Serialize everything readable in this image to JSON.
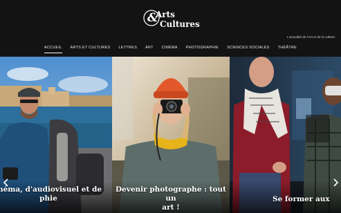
{
  "logo": {
    "line1": "Arts",
    "line2": "Cultures",
    "prefix": "&",
    "tagline": "L'actualité de l'Art et de la culture"
  },
  "nav": {
    "items": [
      {
        "label": "ACCUEIL",
        "active": true
      },
      {
        "label": "ARTS ET CULTURES"
      },
      {
        "label": "LETTRES"
      },
      {
        "label": "ART"
      },
      {
        "label": "CINÉMA"
      },
      {
        "label": "PHOTOGRAPHIE"
      },
      {
        "label": "SCIENCES SOCIALES"
      },
      {
        "label": "THÉÂTRE"
      }
    ]
  },
  "slider": {
    "slides": [
      {
        "caption_line1": "inéma, d'audiovisuel et de",
        "caption_line2": "phie"
      },
      {
        "caption_line1": "Devenir photographe : tout un",
        "caption_line2": "art !"
      },
      {
        "caption_line1": "Se former aux"
      }
    ],
    "prev_icon": "chevron-left-icon",
    "next_icon": "chevron-right-icon"
  },
  "colors": {
    "header_bg": "#131313",
    "text": "#ffffff",
    "beanie": "#e2582a"
  }
}
